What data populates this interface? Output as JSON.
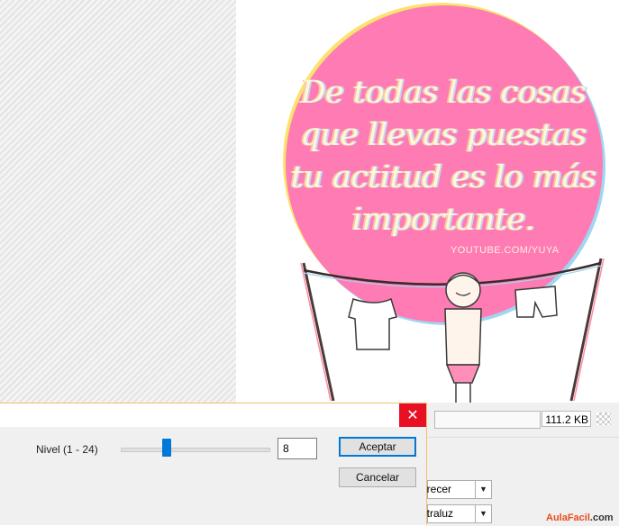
{
  "image": {
    "quote_lines": [
      "De todas las cosas",
      "que llevas puestas",
      "tu actitud es lo más",
      "importante."
    ],
    "watermark": "YOUTUBE.COM/YUYA"
  },
  "status_bar": {
    "file_size": "111.2 KB"
  },
  "panel": {
    "combo1_value": "Oscurecer",
    "combo1_visible": "orecer",
    "combo2_value": "Contraluz",
    "combo2_visible": "ntraluz"
  },
  "dialog": {
    "level_label": "Nivel (1 - 24)",
    "level_value": "8",
    "level_min": 1,
    "level_max": 24,
    "ok_label": "Aceptar",
    "cancel_label": "Cancelar",
    "close_symbol": "✕"
  },
  "brand": {
    "name_part1": "AulaFacil",
    "name_part2": ".com"
  }
}
